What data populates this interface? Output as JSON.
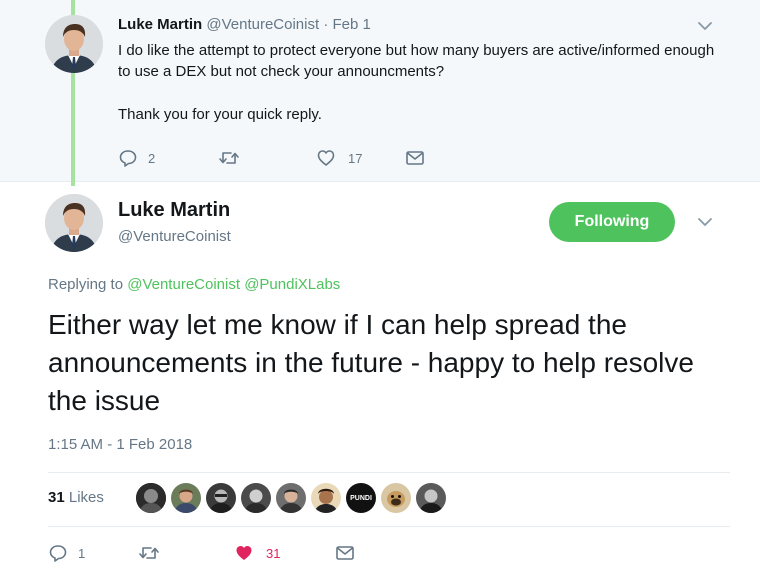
{
  "parent_tweet": {
    "name": "Luke Martin",
    "handle": "@VentureCoinist",
    "separator": "·",
    "date": "Feb 1",
    "text_line1": "I do like the attempt to protect everyone but how many buyers are active/informed enough to use a DEX but not check your announcments?",
    "text_line2": "Thank you for your quick reply.",
    "reply_count": "2",
    "like_count": "17"
  },
  "main_tweet": {
    "name": "Luke Martin",
    "handle": "@VentureCoinist",
    "follow_label": "Following",
    "replying_prefix": "Replying to",
    "replying_to": [
      "@VentureCoinist",
      "@PundiXLabs"
    ],
    "text": "Either way let me know if I can help spread the announcements in the future - happy to help resolve the issue",
    "timestamp": "1:15 AM - 1 Feb 2018",
    "likes_count": "31",
    "likes_label": "Likes",
    "liker_avatar_label": "PUNDI",
    "reply_count": "1",
    "like_count": "31"
  },
  "colors": {
    "accent_green": "#4ec35d",
    "like_red": "#e0245e",
    "muted": "#657786",
    "thread_line": "#a6e3a1"
  },
  "icons": [
    "chevron-down-icon",
    "reply-icon",
    "retweet-icon",
    "heart-icon",
    "heart-filled-icon",
    "message-icon"
  ]
}
